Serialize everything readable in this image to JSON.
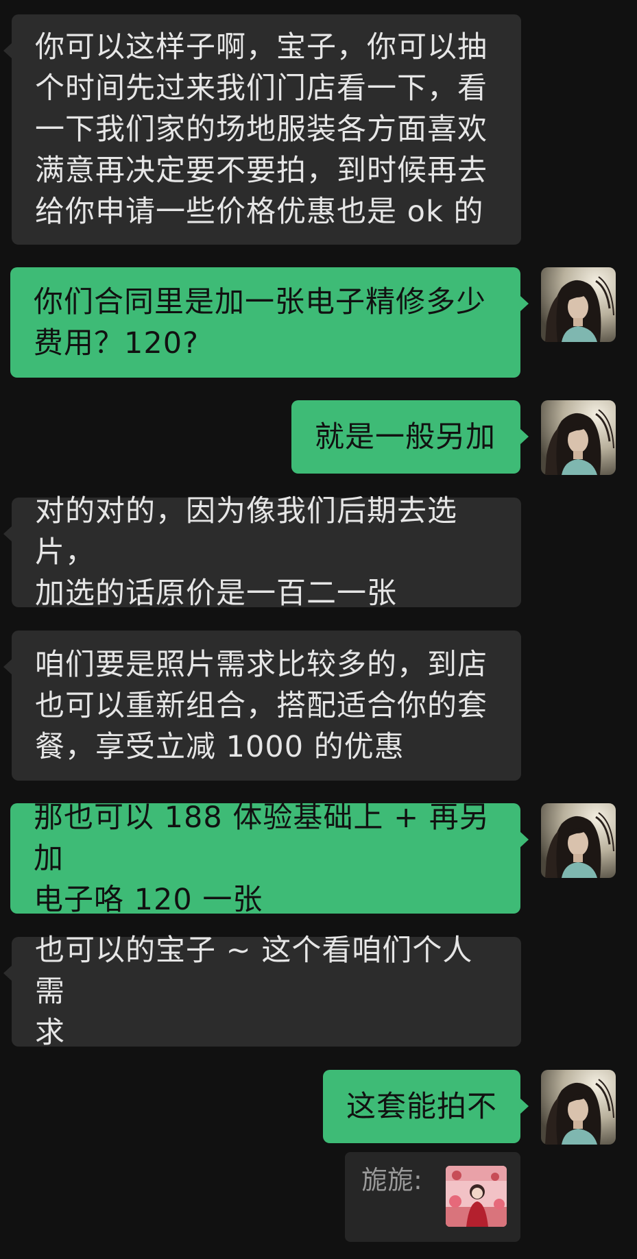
{
  "messages": [
    {
      "side": "in",
      "text": "你可以这样子啊，宝子，你可以抽\n个时间先过来我们门店看一下，看\n一下我们家的场地服装各方面喜欢\n满意再决定要不要拍，到时候再去\n给你申请一些价格优惠也是 ok 的"
    },
    {
      "side": "out",
      "text": "你们合同里是加一张电子精修多少\n费用？120?"
    },
    {
      "side": "out",
      "text": "就是一般另加"
    },
    {
      "side": "in",
      "text": "对的对的，因为像我们后期去选片，\n加选的话原价是一百二一张"
    },
    {
      "side": "in",
      "text": "咱们要是照片需求比较多的，到店\n也可以重新组合，搭配适合你的套\n餐，享受立减 1000 的优惠"
    },
    {
      "side": "out",
      "text": "那也可以 188 体验基础上 + 再另加\n电子咯 120 一张"
    },
    {
      "side": "in",
      "text": "也可以的宝子 ~ 这个看咱们个人需\n求"
    },
    {
      "side": "out",
      "text": "这套能拍不"
    }
  ],
  "quote": {
    "name": "旎旎:",
    "thumbnail_icon": "photo-thumbnail"
  },
  "watermark": "",
  "colors": {
    "background": "#111111",
    "incoming_bubble": "#2c2c2c",
    "outgoing_bubble": "#3ebb76",
    "incoming_text": "#e6e6e6",
    "outgoing_text": "#111111"
  }
}
